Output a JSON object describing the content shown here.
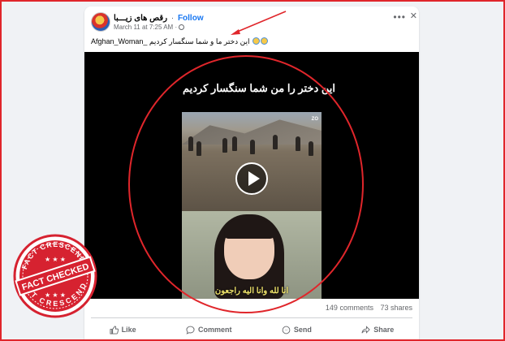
{
  "post": {
    "page_name": "رقص های زیـــبا",
    "separator": "·",
    "follow_label": "Follow",
    "timestamp": "March 11 at 7:25 AM ·",
    "more_icon": "ellipsis-icon",
    "close_icon": "close-icon",
    "caption": "Afghan_Woman_ این دختر ما و شما سنگسار کردیم"
  },
  "video": {
    "title": "این دختر را من شما سنگسار کردیم",
    "subtitle_ar": "انا لله وانا اليه راجعون",
    "overlay_logo": "ZO"
  },
  "stats": {
    "comments": "149 comments",
    "shares": "73 shares"
  },
  "actions": {
    "like": "Like",
    "comment": "Comment",
    "send": "Send",
    "share": "Share"
  },
  "badge": {
    "top_text": "FACT CRESCENDO",
    "main_text": "FACT CHECKED",
    "bottom_text": "FACT CRESCENDO"
  },
  "colors": {
    "accent": "#1877f2",
    "annotation_red": "#e0262b",
    "background": "#f0f2f5"
  }
}
